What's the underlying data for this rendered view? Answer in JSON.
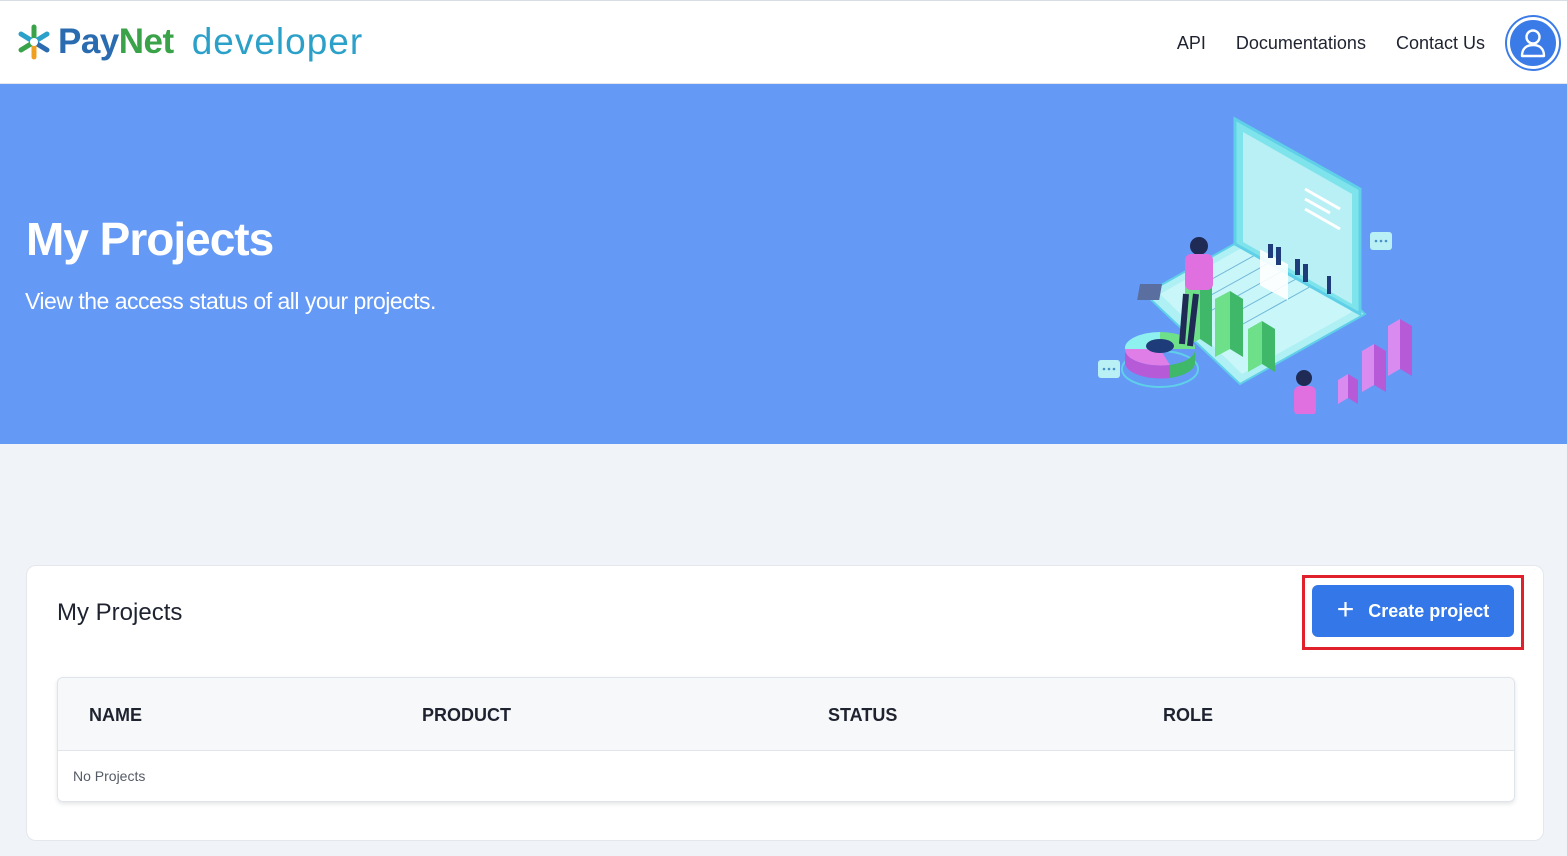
{
  "header": {
    "brand_pay": "PayNet",
    "brand_dev": "developer",
    "nav": [
      {
        "label": "API"
      },
      {
        "label": "Documentations"
      },
      {
        "label": "Contact Us"
      }
    ],
    "avatar_icon": "user-icon"
  },
  "hero": {
    "title": "My Projects",
    "subtitle": "View the access status of all your projects.",
    "background_color": "#6499f6"
  },
  "projects_card": {
    "title": "My Projects",
    "create_button": {
      "icon": "plus-icon",
      "label": "Create project",
      "color": "#3377e8",
      "highlight_color": "#e0202a"
    },
    "table": {
      "columns": [
        "NAME",
        "PRODUCT",
        "STATUS",
        "ROLE"
      ],
      "rows": [],
      "empty_text": "No Projects"
    }
  }
}
